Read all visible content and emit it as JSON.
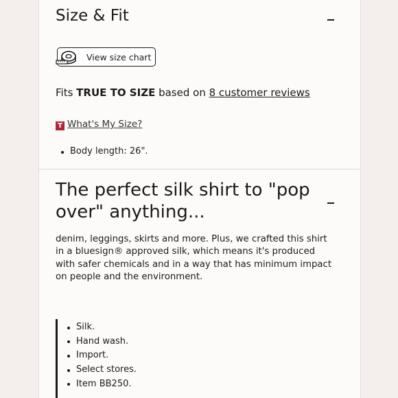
{
  "size_fit": {
    "title": "Size & Fit",
    "collapse_icon": "minus-icon",
    "size_chart_button": {
      "icon": "measuring-tape-icon",
      "label": "View size chart"
    },
    "fits": {
      "prefix": "Fits ",
      "emphasis": "TRUE TO SIZE",
      "middle": " based on ",
      "reviews_link": "8 customer reviews"
    },
    "whats_my_size": {
      "badge": "T",
      "badge_color": "#b0253b",
      "link": "What's My Size?"
    },
    "specs": [
      "Body length: 26\"."
    ]
  },
  "description": {
    "title": "The perfect silk shirt to \"pop over\" anything...",
    "collapse_icon": "minus-icon",
    "body": "denim, leggings, skirts and more. Plus, we crafted this shirt in a bluesign® approved silk, which means it's produced with safer chemicals and in a way that has minimum impact on people and the environment.",
    "details": [
      "Silk.",
      "Hand wash.",
      "Import.",
      "Select stores.",
      "Item BB250."
    ]
  }
}
